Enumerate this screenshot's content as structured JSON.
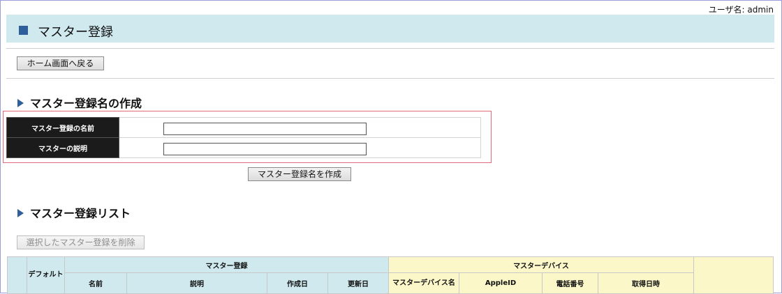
{
  "user": {
    "label": "ユーザ名:",
    "name": "admin"
  },
  "header": {
    "title": "マスター登録"
  },
  "nav": {
    "home_button": "ホーム画面へ戻る"
  },
  "create_section": {
    "heading": "マスター登録名の作成",
    "name_label": "マスター登録の名前",
    "name_value": "",
    "desc_label": "マスターの説明",
    "desc_value": "",
    "submit_button": "マスター登録名を作成"
  },
  "list_section": {
    "heading": "マスター登録リスト",
    "delete_button": "選択したマスター登録を削除",
    "table": {
      "col_default": "デフォルト",
      "group_master": "マスター登録",
      "group_device": "マスターデバイス",
      "col_name": "名前",
      "col_desc": "説明",
      "col_created": "作成日",
      "col_updated": "更新日",
      "col_device_name": "マスターデバイス名",
      "col_apple_id": "AppleID",
      "col_phone": "電話番号",
      "col_acquired": "取得日時"
    }
  },
  "colors": {
    "header_bg": "#cfe9ef",
    "accent": "#2f5f9a",
    "device_bg": "#fbf7c9",
    "highlight_border": "#e06a78"
  }
}
